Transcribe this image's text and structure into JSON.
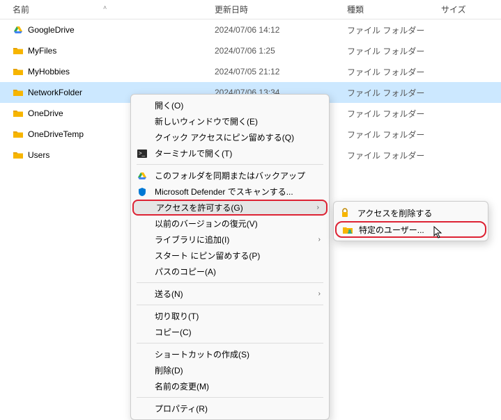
{
  "columns": {
    "name": "名前",
    "date": "更新日時",
    "type": "種類",
    "size": "サイズ"
  },
  "files": [
    {
      "icon": "gdrive",
      "name": "GoogleDrive",
      "date": "2024/07/06 14:12",
      "type": "ファイル フォルダー",
      "selected": false
    },
    {
      "icon": "folder",
      "name": "MyFiles",
      "date": "2024/07/06 1:25",
      "type": "ファイル フォルダー",
      "selected": false
    },
    {
      "icon": "folder",
      "name": "MyHobbies",
      "date": "2024/07/05 21:12",
      "type": "ファイル フォルダー",
      "selected": false
    },
    {
      "icon": "folder",
      "name": "NetworkFolder",
      "date": "2024/07/06 13:34",
      "type": "ファイル フォルダー",
      "selected": true
    },
    {
      "icon": "folder",
      "name": "OneDrive",
      "date": "",
      "type": "ファイル フォルダー",
      "selected": false
    },
    {
      "icon": "folder",
      "name": "OneDriveTemp",
      "date": "",
      "type": "ファイル フォルダー",
      "selected": false
    },
    {
      "icon": "folder",
      "name": "Users",
      "date": "",
      "type": "ファイル フォルダー",
      "selected": false
    }
  ],
  "menu": {
    "open": "開く(O)",
    "open_new_window": "新しいウィンドウで開く(E)",
    "pin_quick_access": "クイック アクセスにピン留めする(Q)",
    "open_terminal": "ターミナルで開く(T)",
    "sync_backup": "このフォルダを同期またはバックアップ",
    "defender_scan": "Microsoft Defender でスキャンする...",
    "grant_access": "アクセスを許可する(G)",
    "restore_versions": "以前のバージョンの復元(V)",
    "add_to_library": "ライブラリに追加(I)",
    "pin_start": "スタート にピン留めする(P)",
    "copy_path": "パスのコピー(A)",
    "send_to": "送る(N)",
    "cut": "切り取り(T)",
    "copy": "コピー(C)",
    "create_shortcut": "ショートカットの作成(S)",
    "delete": "削除(D)",
    "rename": "名前の変更(M)",
    "properties": "プロパティ(R)"
  },
  "submenu": {
    "remove_access": "アクセスを削除する",
    "specific_users": "特定のユーザー..."
  }
}
